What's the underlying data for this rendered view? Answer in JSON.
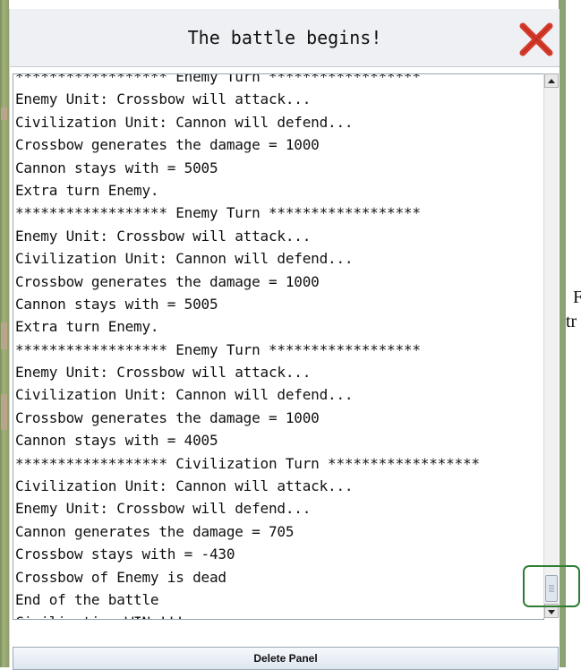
{
  "dialog": {
    "title": "The battle begins!",
    "close_icon": "close-x-icon",
    "close_color": "#d63a2a"
  },
  "log": {
    "lines": [
      "****************** Enemy Turn ******************",
      "Enemy Unit: Crossbow will attack...",
      "Civilization Unit: Cannon will defend...",
      "Crossbow generates the damage = 1000",
      "Cannon stays with = 5005",
      "Extra turn Enemy.",
      "****************** Enemy Turn ******************",
      "Enemy Unit: Crossbow will attack...",
      "Civilization Unit: Cannon will defend...",
      "Crossbow generates the damage = 1000",
      "Cannon stays with = 5005",
      "Extra turn Enemy.",
      "****************** Enemy Turn ******************",
      "Enemy Unit: Crossbow will attack...",
      "Civilization Unit: Cannon will defend...",
      "Crossbow generates the damage = 1000",
      "Cannon stays with = 4005",
      "****************** Civilization Turn ******************",
      "Civilization Unit: Cannon will attack...",
      "Enemy Unit: Crossbow will defend...",
      "Cannon generates the damage = 705",
      "Crossbow stays with = -430",
      "Crossbow of Enemy is dead",
      "End of the battle",
      "Civilization WIN !!!"
    ]
  },
  "buttons": {
    "delete_panel": "Delete Panel"
  },
  "background_text": {
    "fragment_1": "F",
    "fragment_2": "tr"
  },
  "colors": {
    "highlight_ring": "#2f7d32"
  }
}
